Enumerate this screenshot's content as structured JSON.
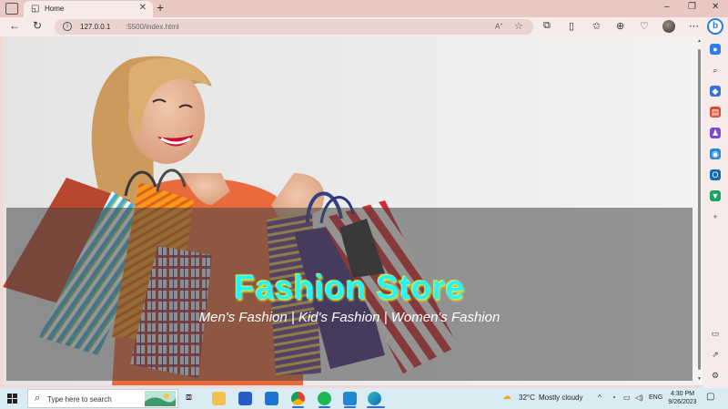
{
  "browser": {
    "tab_title": "Home",
    "url_host": "127.0.0.1",
    "url_path": ":5500/index.html",
    "new_tab_symbol": "+",
    "minimize_symbol": "–",
    "maximize_symbol": "❐",
    "close_symbol": "✕"
  },
  "page": {
    "title": "Fashion Store",
    "subtitle": "Men's Fashion | Kid's Fashion | Women's Fashion",
    "title_color": "#27f2ff",
    "title_glow_color": "#d9f13a"
  },
  "taskbar": {
    "search_placeholder": "Type here to search",
    "weather_temp": "32°C",
    "weather_desc": "Mostly cloudy",
    "language": "ENG",
    "time": "4:30 PM",
    "date": "9/26/2023",
    "apps": [
      "task-view",
      "file-explorer",
      "microsoft-store",
      "mail",
      "chrome",
      "spotify",
      "vscode",
      "edge"
    ]
  }
}
